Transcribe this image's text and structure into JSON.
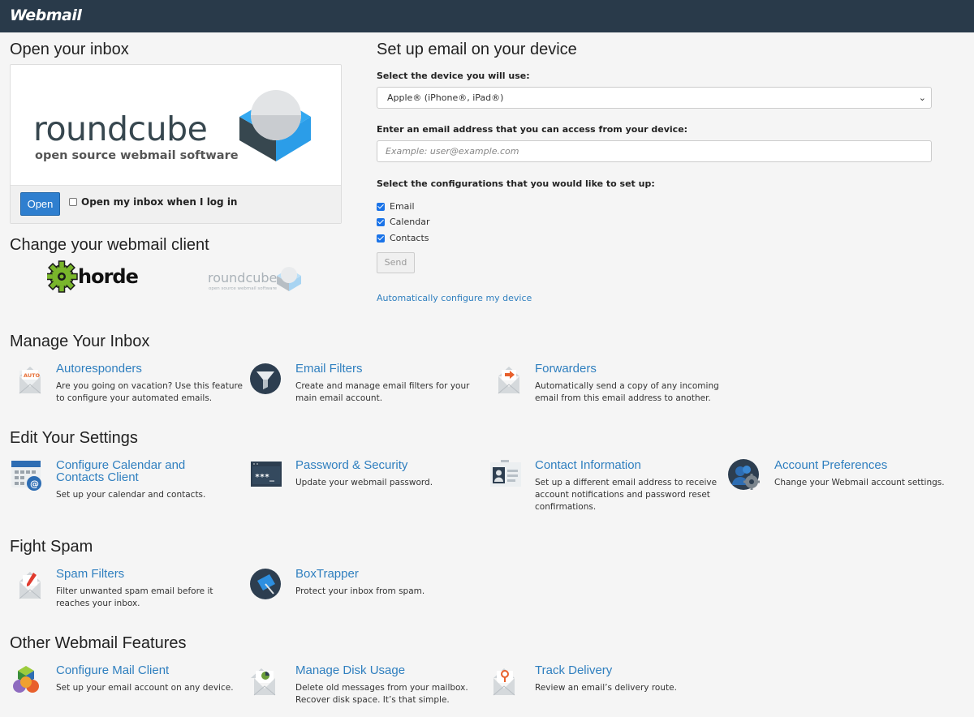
{
  "header": {
    "logo": "Webmail"
  },
  "open_inbox": {
    "heading": "Open your inbox",
    "logo_word": "roundcube",
    "logo_tagline": "open source webmail software",
    "open_button": "Open",
    "auto_open_label": "Open my inbox when I log in"
  },
  "change_client": {
    "heading": "Change your webmail client",
    "clients": [
      {
        "name": "horde"
      },
      {
        "name": "roundcube",
        "tagline": "open source webmail software"
      }
    ]
  },
  "setup": {
    "heading": "Set up email on your device",
    "device_label": "Select the device you will use:",
    "device_selected": "Apple® (iPhone®, iPad®)",
    "email_label": "Enter an email address that you can access from your device:",
    "email_placeholder": "Example: user@example.com",
    "config_label": "Select the configurations that you would like to set up:",
    "configs": [
      "Email",
      "Calendar",
      "Contacts"
    ],
    "send_button": "Send",
    "auto_link": "Automatically configure my device"
  },
  "sections": {
    "manage": {
      "heading": "Manage Your Inbox",
      "items": [
        {
          "title": "Autoresponders",
          "desc": "Are you going on vacation? Use this feature to configure your automated emails.",
          "icon": "autoresponder-icon"
        },
        {
          "title": "Email Filters",
          "desc": "Create and manage email filters for your main email account.",
          "icon": "filter-icon"
        },
        {
          "title": "Forwarders",
          "desc": "Automatically send a copy of any incoming email from this email address to another.",
          "icon": "forwarder-icon"
        }
      ]
    },
    "settings": {
      "heading": "Edit Your Settings",
      "items": [
        {
          "title": "Configure Calendar and Contacts Client",
          "desc": "Set up your calendar and contacts.",
          "icon": "calendar-icon"
        },
        {
          "title": "Password & Security",
          "desc": "Update your webmail password.",
          "icon": "password-icon"
        },
        {
          "title": "Contact Information",
          "desc": "Set up a different email address to receive account notifications and password reset confirmations.",
          "icon": "contact-card-icon"
        },
        {
          "title": "Account Preferences",
          "desc": "Change your Webmail account settings.",
          "icon": "user-gear-icon"
        }
      ]
    },
    "spam": {
      "heading": "Fight Spam",
      "items": [
        {
          "title": "Spam Filters",
          "desc": "Filter unwanted spam email before it reaches your inbox.",
          "icon": "spam-filter-icon"
        },
        {
          "title": "BoxTrapper",
          "desc": "Protect your inbox from spam.",
          "icon": "boxtrapper-icon"
        }
      ]
    },
    "other": {
      "heading": "Other Webmail Features",
      "items": [
        {
          "title": "Configure Mail Client",
          "desc": "Set up your email account on any device.",
          "icon": "mail-client-icon"
        },
        {
          "title": "Manage Disk Usage",
          "desc": "Delete old messages from your mailbox. Recover disk space. It’s that simple.",
          "icon": "disk-usage-icon"
        },
        {
          "title": "Track Delivery",
          "desc": "Review an email’s delivery route.",
          "icon": "track-delivery-icon"
        }
      ]
    }
  }
}
